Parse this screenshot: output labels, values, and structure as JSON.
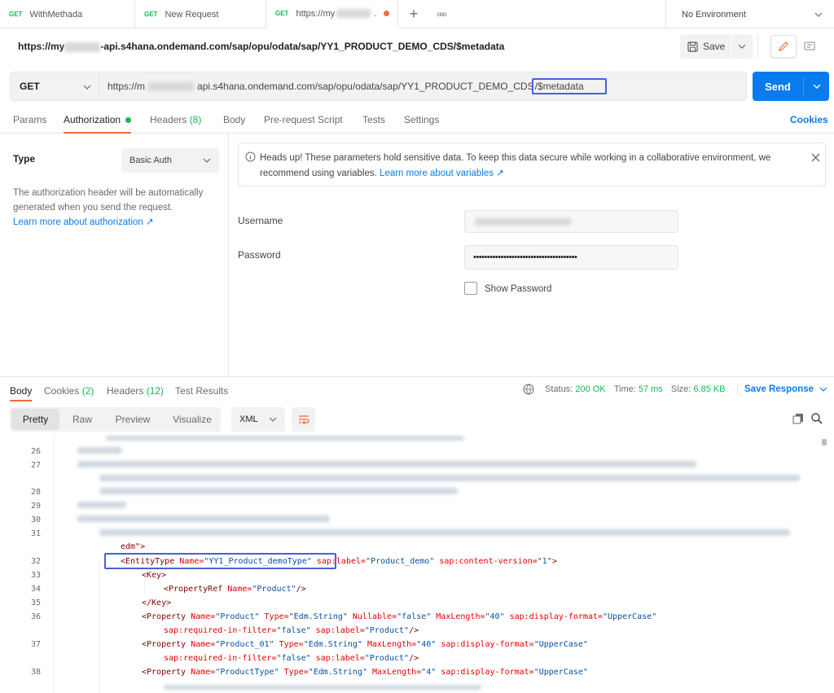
{
  "tabs": [
    {
      "method": "GET",
      "label": "WithMethada"
    },
    {
      "method": "GET",
      "label": "New Request"
    },
    {
      "method": "GET",
      "label": "https://my"
    }
  ],
  "plus_icon": "+",
  "more_icon": "ooo",
  "environment": "No Environment",
  "request_title": {
    "prefix": "https://my",
    "suffix": "-api.s4hana.ondemand.com/sap/opu/odata/sap/YY1_PRODUCT_DEMO_CDS/$metadata"
  },
  "save_label": "Save",
  "method": "GET",
  "url": {
    "prefix": "https://m",
    "middle": "api.s4hana.ondemand.com/sap/opu/odata/sap/YY1_PRODUCT_DEMO_CDS",
    "highlight": "/$metadata"
  },
  "send_label": "Send",
  "request_tabs": {
    "params": "Params",
    "authorization": "Authorization",
    "headers": "Headers",
    "headers_count": "(8)",
    "body": "Body",
    "prerequest": "Pre-request Script",
    "tests": "Tests",
    "settings": "Settings",
    "cookies": "Cookies"
  },
  "auth": {
    "type_label": "Type",
    "type_value": "Basic Auth",
    "description": "The authorization header will be automatically generated when you send the request.",
    "learn_more": "Learn more about authorization ↗",
    "notice": "Heads up! These parameters hold sensitive data. To keep this data secure while working in a collaborative environment, we recommend using variables.",
    "notice_link": "Learn more about variables ↗",
    "username_label": "Username",
    "password_label": "Password",
    "password_value": "••••••••••••••••••••••••••••••••••••••",
    "show_password": "Show Password"
  },
  "response_tabs": {
    "body": "Body",
    "cookies": "Cookies",
    "cookies_count": "(2)",
    "headers": "Headers",
    "headers_count": "(12)",
    "test_results": "Test Results"
  },
  "status": {
    "status_label": "Status:",
    "status_value": "200 OK",
    "time_label": "Time:",
    "time_value": "57 ms",
    "size_label": "Size:",
    "size_value": "6.85 KB",
    "save_response": "Save Response"
  },
  "view_modes": {
    "pretty": "Pretty",
    "raw": "Raw",
    "preview": "Preview",
    "visualize": "Visualize",
    "format": "XML"
  },
  "code": {
    "line_numbers": [
      "26",
      "27",
      "28",
      "29",
      "30",
      "31",
      "32",
      "33",
      "34",
      "35",
      "36",
      "37",
      "38"
    ],
    "l31_cont": "edm\">",
    "l32": {
      "open": "<EntityType ",
      "a1": "Name=",
      "v1": "\"YY1_Product_demoType\"",
      "a2": " sap:label=",
      "v2": "\"Product_demo\"",
      "a3": " sap:content-version=",
      "v3": "\"1\"",
      "close": ">"
    },
    "l33": "<Key>",
    "l34": {
      "open": "<PropertyRef ",
      "a1": "Name=",
      "v1": "\"Product\"",
      "close": "/>"
    },
    "l35": "</Key>",
    "l36": {
      "open": "<Property ",
      "a1": "Name=",
      "v1": "\"Product\"",
      "a2": " Type=",
      "v2": "\"Edm.String\"",
      "a3": " Nullable=",
      "v3": "\"false\"",
      "a4": " MaxLength=",
      "v4": "\"40\"",
      "a5": " sap:display-format=",
      "v5": "\"UpperCase\""
    },
    "l36b": {
      "a1": "sap:required-in-filter=",
      "v1": "\"false\"",
      "a2": " sap:label=",
      "v2": "\"Product\"",
      "close": "/>"
    },
    "l37": {
      "open": "<Property ",
      "a1": "Name=",
      "v1": "\"Product_01\"",
      "a2": " Type=",
      "v2": "\"Edm.String\"",
      "a3": " MaxLength=",
      "v3": "\"40\"",
      "a4": " sap:display-format=",
      "v4": "\"UpperCase\""
    },
    "l37b": {
      "a1": "sap:required-in-filter=",
      "v1": "\"false\"",
      "a2": " sap:label=",
      "v2": "\"Product\"",
      "close": "/>"
    },
    "l38": {
      "open": "<Property ",
      "a1": "Name=",
      "v1": "\"ProductType\"",
      "a2": " Type=",
      "v2": "\"Edm.String\"",
      "a3": " MaxLength=",
      "v3": "\"4\"",
      "a4": " sap:display-format=",
      "v4": "\"UpperCase\""
    }
  },
  "colors": {
    "accent": "#f26b3a",
    "send": "#097bed",
    "status_green": "#0cbb52",
    "highlight_box": "#4a5fdc"
  }
}
